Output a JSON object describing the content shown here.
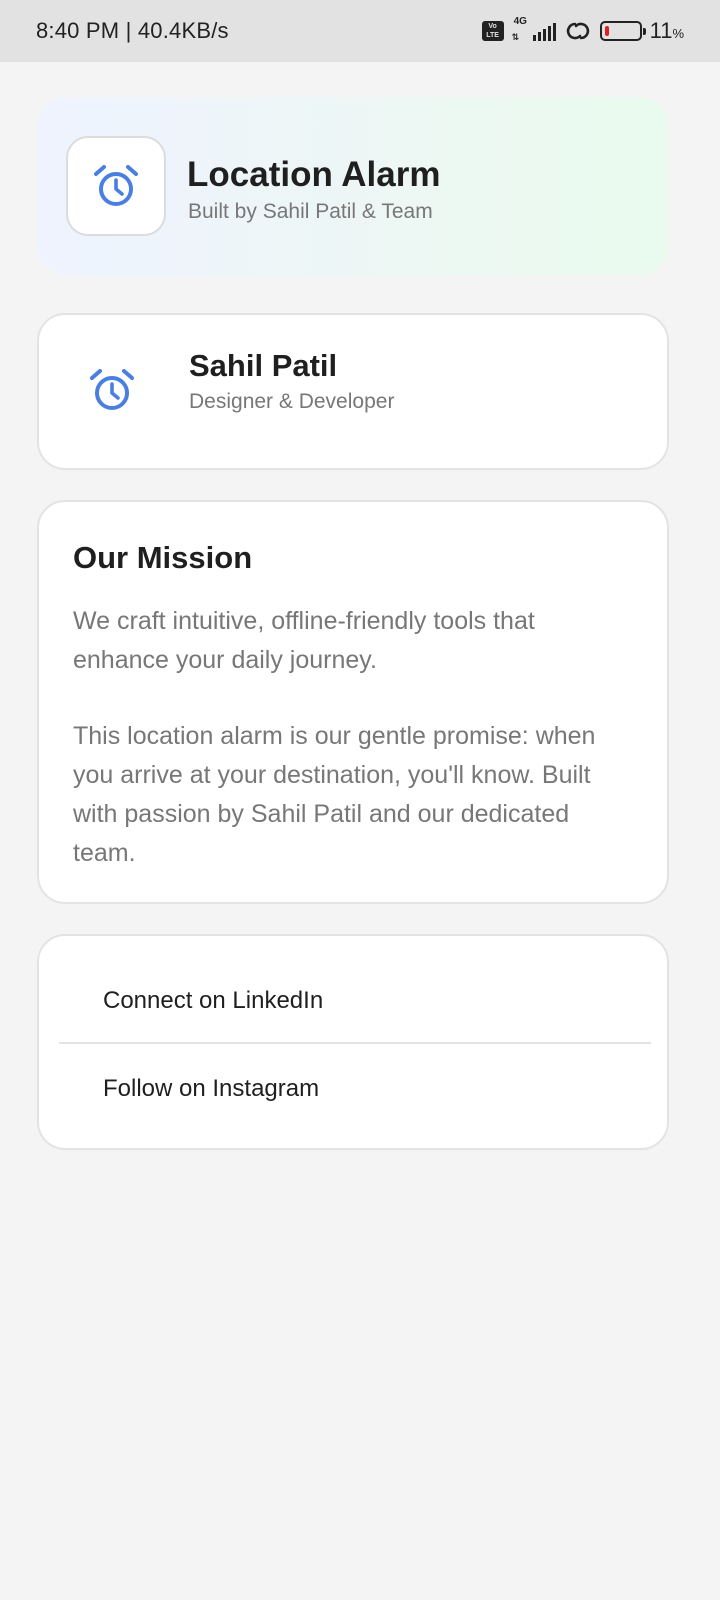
{
  "status_bar": {
    "time_speed": "8:40 PM | 40.4KB/s",
    "volte": "Vo LTE",
    "network_type": "4G",
    "battery_percent": "11",
    "battery_unit": "%",
    "battery_level": 0.11,
    "battery_color": "#e02020"
  },
  "hero": {
    "title": "Location Alarm",
    "subtitle": "Built by Sahil Patil & Team",
    "icon": "alarm-clock-icon"
  },
  "person": {
    "name": "Sahil Patil",
    "role": "Designer & Developer",
    "icon": "alarm-clock-icon"
  },
  "mission": {
    "title": "Our Mission",
    "paragraph1": "We craft intuitive, offline-friendly tools that enhance your daily journey.",
    "paragraph2": "This location alarm is our gentle promise: when you arrive at your destination, you'll know. Built with passion by Sahil Patil and our dedicated team."
  },
  "links": {
    "linkedin": "Connect on LinkedIn",
    "instagram": "Follow on Instagram"
  },
  "colors": {
    "accent": "#4a7fe0",
    "background": "#f4f4f5",
    "secondary_text": "#777777"
  }
}
